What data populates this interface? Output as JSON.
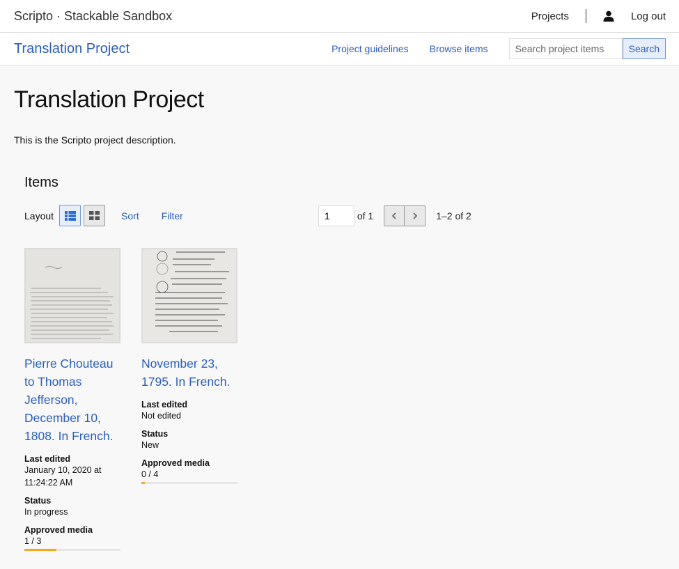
{
  "topbar": {
    "brand": "Scripto · Stackable Sandbox",
    "projects_link": "Projects",
    "user_icon": "user-icon",
    "logout_link": "Log out"
  },
  "projbar": {
    "title": "Translation Project",
    "guidelines_link": "Project guidelines",
    "browse_link": "Browse items",
    "search_placeholder": "Search project items",
    "search_button": "Search"
  },
  "main": {
    "title": "Translation Project",
    "description": "This is the Scripto project description."
  },
  "items": {
    "heading": "Items",
    "layout_label": "Layout",
    "layout_list_icon": "list-layout-icon",
    "layout_grid_icon": "grid-layout-icon",
    "sort_label": "Sort",
    "filter_label": "Filter",
    "page_value": "1",
    "of_text": "of 1",
    "prev_icon": "chevron-left-icon",
    "next_icon": "chevron-right-icon",
    "range_text": "1–2 of 2",
    "cards": [
      {
        "title": "Pierre Chouteau to Thomas Jefferson, December 10, 1808. In French.",
        "last_edited_label": "Last edited",
        "last_edited": "January 10, 2020 at 11:24:22 AM",
        "status_label": "Status",
        "status": "In progress",
        "approved_label": "Approved media",
        "approved": "1 / 3",
        "approved_fraction": 0.333
      },
      {
        "title": "November 23, 1795. In French.",
        "last_edited_label": "Last edited",
        "last_edited": "Not edited",
        "status_label": "Status",
        "status": "New",
        "approved_label": "Approved media",
        "approved": "0 / 4",
        "approved_fraction": 0.0
      }
    ]
  },
  "colors": {
    "link": "#2b5fb8",
    "progress": "#f5a623",
    "background": "#f8f8f8"
  }
}
